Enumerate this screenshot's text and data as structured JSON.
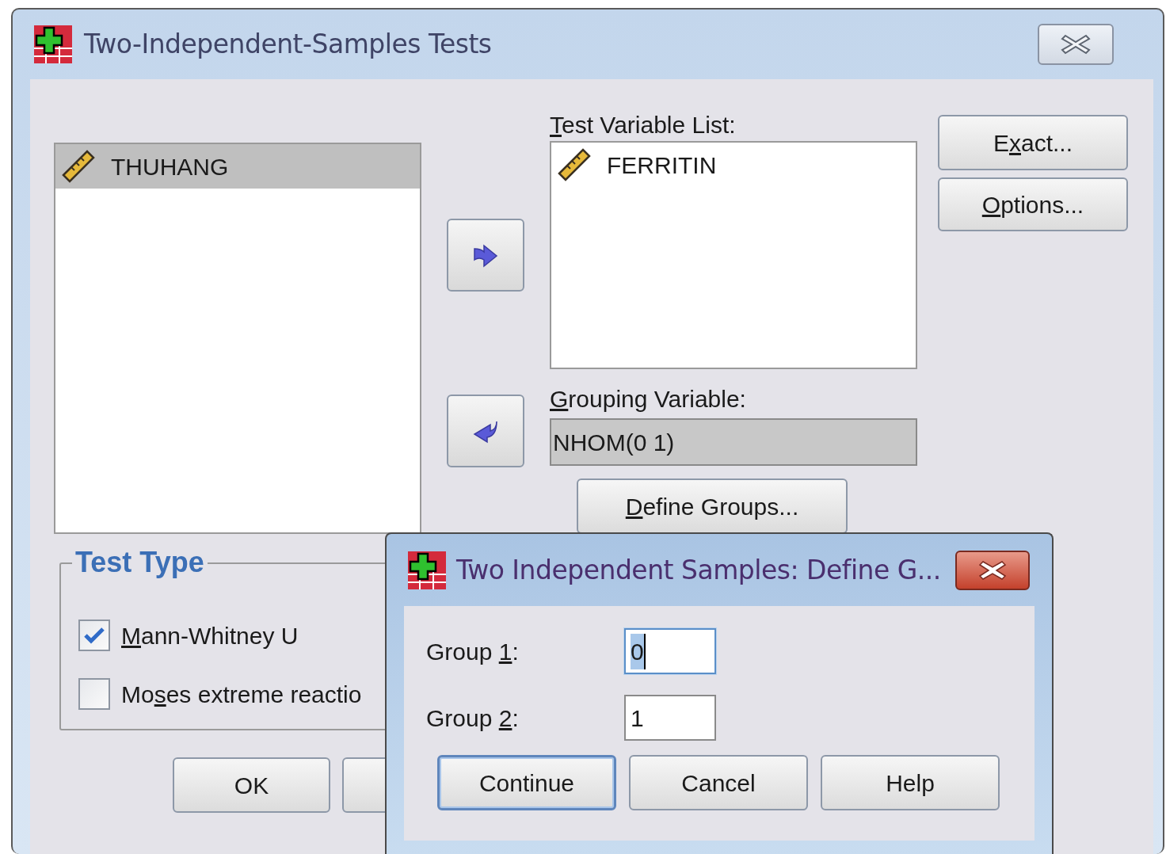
{
  "window": {
    "title": "Two-Independent-Samples Tests"
  },
  "source_list": {
    "items": [
      {
        "name": "THUHANG",
        "selected": true
      }
    ]
  },
  "move_buttons": [
    {
      "kind": "right"
    },
    {
      "kind": "left"
    }
  ],
  "test_variable_list": {
    "label": {
      "key": "T",
      "after": "est Variable List:"
    },
    "items": [
      {
        "name": "FERRITIN",
        "selected": false
      }
    ]
  },
  "grouping_variable": {
    "label": {
      "key": "G",
      "after": "rouping Variable:"
    },
    "value": "NHOM(0 1)",
    "read_only": true
  },
  "define_groups_button": {
    "label": {
      "key": "D",
      "after": "efine Groups..."
    }
  },
  "side_buttons": [
    {
      "label": {
        "before": "E",
        "key": "x",
        "after": "act..."
      }
    },
    {
      "label": {
        "key": "O",
        "after": "ptions..."
      }
    }
  ],
  "test_type": {
    "title": "Test Type",
    "options": [
      {
        "label": {
          "key": "M",
          "after": "ann-Whitney U"
        },
        "checked": true
      },
      {
        "label": {
          "before": "Mo",
          "key": "s",
          "after": "es extreme reactio"
        },
        "checked": false
      }
    ]
  },
  "buttons": [
    {
      "kind": "text",
      "label": "OK"
    },
    {
      "kind": "covered"
    }
  ],
  "define_groups_dialog": {
    "title": "Two Independent Samples: Define G...",
    "fields": [
      {
        "label": {
          "before": "Group ",
          "key": "1",
          "after": ":"
        },
        "value": "0",
        "focused": true
      },
      {
        "label": {
          "before": "Group ",
          "key": "2",
          "after": ":"
        },
        "value": "1",
        "focused": false
      }
    ],
    "buttons": [
      {
        "label": "Continue",
        "default": true
      },
      {
        "label": "Cancel",
        "default": false
      },
      {
        "label": "Help",
        "default": false
      }
    ]
  }
}
